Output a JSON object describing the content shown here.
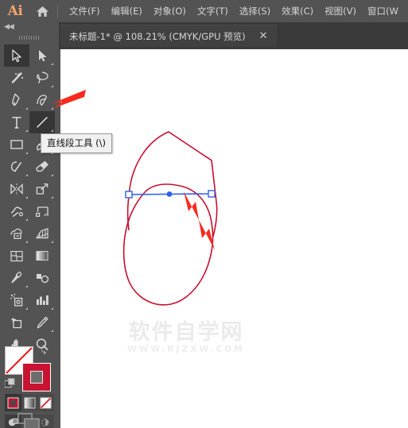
{
  "app": {
    "logo": "Ai",
    "home_icon": "home-icon"
  },
  "menubar": {
    "items": [
      {
        "label": "文件(F)"
      },
      {
        "label": "编辑(E)"
      },
      {
        "label": "对象(O)"
      },
      {
        "label": "文字(T)"
      },
      {
        "label": "选择(S)"
      },
      {
        "label": "效果(C)"
      },
      {
        "label": "视图(V)"
      },
      {
        "label": "窗口(W"
      }
    ]
  },
  "tabbar": {
    "document_title": "未标题-1* @ 108.21% (CMYK/GPU 预览)",
    "close_label": "✕"
  },
  "tooltip": {
    "text": "直线段工具 (\\)"
  },
  "toolpanel": {
    "collapse_label": "◀◀",
    "tools": [
      {
        "name": "selection-tool",
        "active": true,
        "corner": false
      },
      {
        "name": "direct-selection-tool",
        "active": false,
        "corner": true
      },
      {
        "name": "magic-wand-tool",
        "active": false,
        "corner": false
      },
      {
        "name": "lasso-tool",
        "active": false,
        "corner": false
      },
      {
        "name": "pen-tool",
        "active": false,
        "corner": true
      },
      {
        "name": "curvature-tool",
        "active": false,
        "corner": false
      },
      {
        "name": "type-tool",
        "active": false,
        "corner": true
      },
      {
        "name": "line-segment-tool",
        "active": true,
        "corner": true
      },
      {
        "name": "rectangle-tool",
        "active": false,
        "corner": true
      },
      {
        "name": "paintbrush-tool",
        "active": false,
        "corner": true
      },
      {
        "name": "shaper-tool",
        "active": false,
        "corner": true
      },
      {
        "name": "eraser-tool",
        "active": false,
        "corner": true
      },
      {
        "name": "rotate-tool",
        "active": false,
        "corner": true
      },
      {
        "name": "scale-tool",
        "active": false,
        "corner": true
      },
      {
        "name": "width-tool",
        "active": false,
        "corner": true
      },
      {
        "name": "free-transform-tool",
        "active": false,
        "corner": false
      },
      {
        "name": "shape-builder-tool",
        "active": false,
        "corner": true
      },
      {
        "name": "perspective-grid-tool",
        "active": false,
        "corner": true
      },
      {
        "name": "mesh-tool",
        "active": false,
        "corner": false
      },
      {
        "name": "gradient-tool",
        "active": false,
        "corner": false
      },
      {
        "name": "eyedropper-tool",
        "active": false,
        "corner": true
      },
      {
        "name": "blend-tool",
        "active": false,
        "corner": false
      },
      {
        "name": "symbol-sprayer-tool",
        "active": false,
        "corner": true
      },
      {
        "name": "column-graph-tool",
        "active": false,
        "corner": true
      },
      {
        "name": "artboard-tool",
        "active": false,
        "corner": false
      },
      {
        "name": "slice-tool",
        "active": false,
        "corner": true
      },
      {
        "name": "hand-tool",
        "active": false,
        "corner": true
      },
      {
        "name": "zoom-tool",
        "active": false,
        "corner": false
      }
    ],
    "colors": {
      "fill": "#ffffff",
      "fill_is_none": true,
      "stroke": "#c81432",
      "swap_icon": "swap-arrow-icon",
      "default_icon": "default-colors-icon"
    },
    "paint_modes": [
      {
        "name": "color-swatch-mode",
        "selected": true
      },
      {
        "name": "gradient-mode",
        "selected": false
      },
      {
        "name": "none-mode",
        "selected": false
      }
    ],
    "draw_modes": [
      {
        "name": "draw-normal-mode",
        "selected": true
      },
      {
        "name": "draw-behind-mode",
        "selected": false
      },
      {
        "name": "draw-inside-mode",
        "selected": false
      }
    ],
    "screen_mode": {
      "name": "change-screen-mode-icon"
    }
  },
  "canvas": {
    "watermark_main": "软件自学网",
    "watermark_sub": "WWW.RJZXW.COM",
    "artwork": {
      "stroke_color": "#c8102e",
      "selection_color": "#2d5fe8",
      "anchor_fill": "#ffffff",
      "description": "curved-closed-path-with-selected-line-segment"
    },
    "annotations": [
      {
        "name": "arrow-to-line-tool",
        "color": "#fa2a1e"
      },
      {
        "name": "arrow-to-line-segment",
        "color": "#fa2a1e"
      }
    ]
  }
}
